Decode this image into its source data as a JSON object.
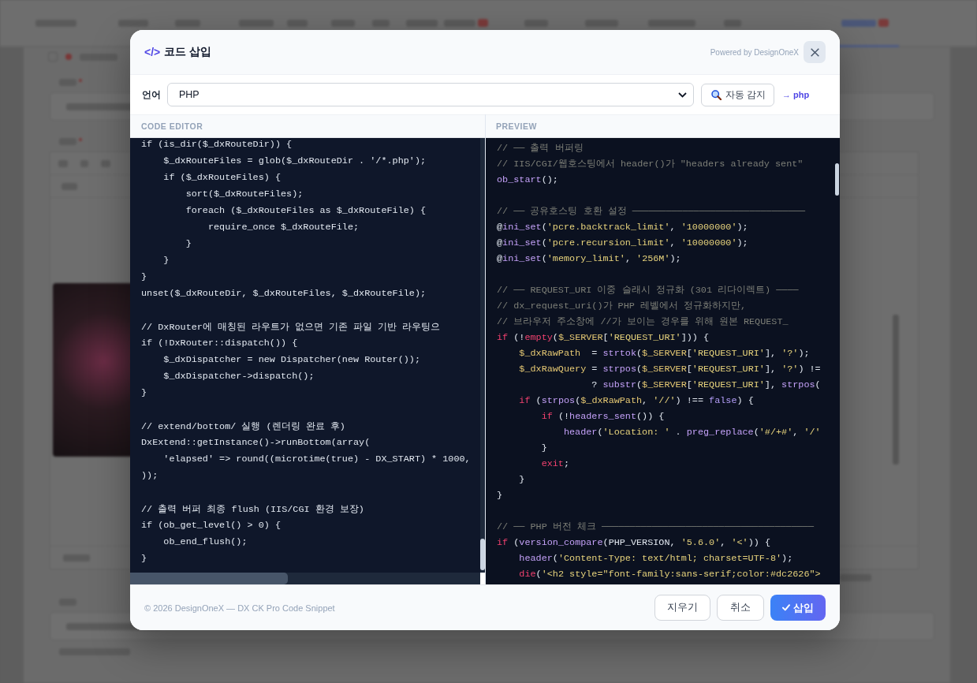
{
  "dialog": {
    "title_icon": "</>",
    "title": "코드 삽입",
    "powered_by": "Powered by DesignOneX"
  },
  "language": {
    "label": "언어",
    "value": "PHP",
    "detect_button": "자동 감지",
    "detected": "→ php"
  },
  "panes": [
    {
      "kind": "editor",
      "heading": "CODE EDITOR",
      "lines": [
        {
          "kind": "code",
          "text": "if (is_dir($_dxRouteDir)) {"
        },
        {
          "kind": "code",
          "text": "    $_dxRouteFiles = glob($_dxRouteDir . '/*.php');"
        },
        {
          "kind": "code",
          "text": "    if ($_dxRouteFiles) {"
        },
        {
          "kind": "code",
          "text": "        sort($_dxRouteFiles);"
        },
        {
          "kind": "code",
          "text": "        foreach ($_dxRouteFiles as $_dxRouteFile) {"
        },
        {
          "kind": "code",
          "text": "            require_once $_dxRouteFile;"
        },
        {
          "kind": "code",
          "text": "        }"
        },
        {
          "kind": "code",
          "text": "    }"
        },
        {
          "kind": "code",
          "text": "}"
        },
        {
          "kind": "code",
          "text": "unset($_dxRouteDir, $_dxRouteFiles, $_dxRouteFile);"
        },
        {
          "kind": "blank"
        },
        {
          "kind": "code",
          "text": "// DxRouter에 매칭된 라우트가 없으면 기존 파일 기반 라우팅으"
        },
        {
          "kind": "code",
          "text": "if (!DxRouter::dispatch()) {"
        },
        {
          "kind": "code",
          "text": "    $_dxDispatcher = new Dispatcher(new Router());"
        },
        {
          "kind": "code",
          "text": "    $_dxDispatcher->dispatch();"
        },
        {
          "kind": "code",
          "text": "}"
        },
        {
          "kind": "blank"
        },
        {
          "kind": "code",
          "text": "// extend/bottom/ 실행 (렌더링 완료 후)"
        },
        {
          "kind": "code",
          "text": "DxExtend::getInstance()->runBottom(array("
        },
        {
          "kind": "code",
          "text": "    'elapsed' => round((microtime(true) - DX_START) * 1000,"
        },
        {
          "kind": "code",
          "text": "));"
        },
        {
          "kind": "blank"
        },
        {
          "kind": "code",
          "text": "// 출력 버퍼 최종 flush (IIS/CGI 환경 보장)"
        },
        {
          "kind": "code",
          "text": "if (ob_get_level() > 0) {"
        },
        {
          "kind": "code",
          "text": "    ob_end_flush();"
        },
        {
          "kind": "code",
          "text": "}"
        }
      ]
    },
    {
      "kind": "preview",
      "heading": "PREVIEW",
      "lines": [
        {
          "kind": "code",
          "tokens": [
            {
              "kind": "comment",
              "text": "// ── 출력 버퍼링"
            }
          ]
        },
        {
          "kind": "code",
          "tokens": [
            {
              "kind": "comment",
              "text": "// IIS/CGI/웹호스팅에서 header()가 \"headers already sent\""
            }
          ]
        },
        {
          "kind": "code",
          "tokens": [
            {
              "kind": "function",
              "text": "ob_start"
            },
            {
              "kind": "plain",
              "text": "();"
            }
          ]
        },
        {
          "kind": "blank"
        },
        {
          "kind": "code",
          "tokens": [
            {
              "kind": "comment",
              "text": "// ── 공유호스팅 호환 설정 ───────────────────────────────"
            }
          ]
        },
        {
          "kind": "code",
          "tokens": [
            {
              "kind": "plain",
              "text": "@"
            },
            {
              "kind": "function",
              "text": "ini_set"
            },
            {
              "kind": "plain",
              "text": "("
            },
            {
              "kind": "string",
              "text": "'pcre.backtrack_limit'"
            },
            {
              "kind": "plain",
              "text": ", "
            },
            {
              "kind": "string",
              "text": "'10000000'"
            },
            {
              "kind": "plain",
              "text": ");"
            }
          ]
        },
        {
          "kind": "code",
          "tokens": [
            {
              "kind": "plain",
              "text": "@"
            },
            {
              "kind": "function",
              "text": "ini_set"
            },
            {
              "kind": "plain",
              "text": "("
            },
            {
              "kind": "string",
              "text": "'pcre.recursion_limit'"
            },
            {
              "kind": "plain",
              "text": ", "
            },
            {
              "kind": "string",
              "text": "'10000000'"
            },
            {
              "kind": "plain",
              "text": ");"
            }
          ]
        },
        {
          "kind": "code",
          "tokens": [
            {
              "kind": "plain",
              "text": "@"
            },
            {
              "kind": "function",
              "text": "ini_set"
            },
            {
              "kind": "plain",
              "text": "("
            },
            {
              "kind": "string",
              "text": "'memory_limit'"
            },
            {
              "kind": "plain",
              "text": ", "
            },
            {
              "kind": "string",
              "text": "'256M'"
            },
            {
              "kind": "plain",
              "text": ");"
            }
          ]
        },
        {
          "kind": "blank"
        },
        {
          "kind": "code",
          "tokens": [
            {
              "kind": "comment",
              "text": "// ── REQUEST_URI 이중 슬래시 정규화 (301 리다이렉트) ────"
            }
          ]
        },
        {
          "kind": "code",
          "tokens": [
            {
              "kind": "comment",
              "text": "// dx_request_uri()가 PHP 레벨에서 정규화하지만,"
            }
          ]
        },
        {
          "kind": "code",
          "tokens": [
            {
              "kind": "comment",
              "text": "// 브라우저 주소창에 //가 보이는 경우를 위해 원본 REQUEST_"
            }
          ]
        },
        {
          "kind": "code",
          "tokens": [
            {
              "kind": "keyword",
              "text": "if"
            },
            {
              "kind": "plain",
              "text": " (!"
            },
            {
              "kind": "keyword",
              "text": "empty"
            },
            {
              "kind": "plain",
              "text": "("
            },
            {
              "kind": "variable",
              "text": "$_SERVER"
            },
            {
              "kind": "plain",
              "text": "["
            },
            {
              "kind": "string",
              "text": "'REQUEST_URI'"
            },
            {
              "kind": "plain",
              "text": "])) {"
            }
          ]
        },
        {
          "kind": "code",
          "tokens": [
            {
              "kind": "variable",
              "text": "    $_dxRawPath"
            },
            {
              "kind": "plain",
              "text": "  = "
            },
            {
              "kind": "function",
              "text": "strtok"
            },
            {
              "kind": "plain",
              "text": "("
            },
            {
              "kind": "variable",
              "text": "$_SERVER"
            },
            {
              "kind": "plain",
              "text": "["
            },
            {
              "kind": "string",
              "text": "'REQUEST_URI'"
            },
            {
              "kind": "plain",
              "text": "], "
            },
            {
              "kind": "string",
              "text": "'?'"
            },
            {
              "kind": "plain",
              "text": ");"
            }
          ]
        },
        {
          "kind": "code",
          "tokens": [
            {
              "kind": "variable",
              "text": "    $_dxRawQuery"
            },
            {
              "kind": "plain",
              "text": " = "
            },
            {
              "kind": "function",
              "text": "strpos"
            },
            {
              "kind": "plain",
              "text": "("
            },
            {
              "kind": "variable",
              "text": "$_SERVER"
            },
            {
              "kind": "plain",
              "text": "["
            },
            {
              "kind": "string",
              "text": "'REQUEST_URI'"
            },
            {
              "kind": "plain",
              "text": "], "
            },
            {
              "kind": "string",
              "text": "'?'"
            },
            {
              "kind": "plain",
              "text": ") !="
            }
          ]
        },
        {
          "kind": "code",
          "tokens": [
            {
              "kind": "plain",
              "text": "                 ? "
            },
            {
              "kind": "function",
              "text": "substr"
            },
            {
              "kind": "plain",
              "text": "("
            },
            {
              "kind": "variable",
              "text": "$_SERVER"
            },
            {
              "kind": "plain",
              "text": "["
            },
            {
              "kind": "string",
              "text": "'REQUEST_URI'"
            },
            {
              "kind": "plain",
              "text": "], "
            },
            {
              "kind": "function",
              "text": "strpos"
            },
            {
              "kind": "plain",
              "text": "("
            }
          ]
        },
        {
          "kind": "code",
          "tokens": [
            {
              "kind": "keyword",
              "text": "    if"
            },
            {
              "kind": "plain",
              "text": " ("
            },
            {
              "kind": "function",
              "text": "strpos"
            },
            {
              "kind": "plain",
              "text": "("
            },
            {
              "kind": "variable",
              "text": "$_dxRawPath"
            },
            {
              "kind": "plain",
              "text": ", "
            },
            {
              "kind": "string",
              "text": "'//'"
            },
            {
              "kind": "plain",
              "text": ") !== "
            },
            {
              "kind": "literal",
              "text": "false"
            },
            {
              "kind": "plain",
              "text": ") {"
            }
          ]
        },
        {
          "kind": "code",
          "tokens": [
            {
              "kind": "keyword",
              "text": "        if"
            },
            {
              "kind": "plain",
              "text": " (!"
            },
            {
              "kind": "function",
              "text": "headers_sent"
            },
            {
              "kind": "plain",
              "text": "()) {"
            }
          ]
        },
        {
          "kind": "code",
          "tokens": [
            {
              "kind": "function",
              "text": "            header"
            },
            {
              "kind": "plain",
              "text": "("
            },
            {
              "kind": "string",
              "text": "'Location: '"
            },
            {
              "kind": "plain",
              "text": " . "
            },
            {
              "kind": "function",
              "text": "preg_replace"
            },
            {
              "kind": "plain",
              "text": "("
            },
            {
              "kind": "string",
              "text": "'#/+#'"
            },
            {
              "kind": "plain",
              "text": ", "
            },
            {
              "kind": "string",
              "text": "'/'"
            }
          ]
        },
        {
          "kind": "code",
          "tokens": [
            {
              "kind": "plain",
              "text": "        }"
            }
          ]
        },
        {
          "kind": "code",
          "tokens": [
            {
              "kind": "keyword",
              "text": "        exit"
            },
            {
              "kind": "plain",
              "text": ";"
            }
          ]
        },
        {
          "kind": "code",
          "tokens": [
            {
              "kind": "plain",
              "text": "    }"
            }
          ]
        },
        {
          "kind": "code",
          "tokens": [
            {
              "kind": "plain",
              "text": "}"
            }
          ]
        },
        {
          "kind": "blank"
        },
        {
          "kind": "code",
          "tokens": [
            {
              "kind": "comment",
              "text": "// ── PHP 버전 체크 ──────────────────────────────────────"
            }
          ]
        },
        {
          "kind": "code",
          "tokens": [
            {
              "kind": "keyword",
              "text": "if"
            },
            {
              "kind": "plain",
              "text": " ("
            },
            {
              "kind": "function",
              "text": "version_compare"
            },
            {
              "kind": "plain",
              "text": "(PHP_VERSION, "
            },
            {
              "kind": "string",
              "text": "'5.6.0'"
            },
            {
              "kind": "plain",
              "text": ", "
            },
            {
              "kind": "string",
              "text": "'<'"
            },
            {
              "kind": "plain",
              "text": ")) {"
            }
          ]
        },
        {
          "kind": "code",
          "tokens": [
            {
              "kind": "function",
              "text": "    header"
            },
            {
              "kind": "plain",
              "text": "("
            },
            {
              "kind": "string",
              "text": "'Content-Type: text/html; charset=UTF-8'"
            },
            {
              "kind": "plain",
              "text": ");"
            }
          ]
        },
        {
          "kind": "code",
          "tokens": [
            {
              "kind": "keyword",
              "text": "    die"
            },
            {
              "kind": "plain",
              "text": "("
            },
            {
              "kind": "string",
              "text": "'<h2 style=\"font-family:sans-serif;color:#dc2626\">"
            }
          ]
        }
      ]
    }
  ],
  "footer": {
    "copyright": "© 2026 DesignOneX — DX CK Pro Code Snippet",
    "buttons": [
      {
        "label": "지우기",
        "kind": "secondary"
      },
      {
        "label": "취소",
        "kind": "secondary"
      },
      {
        "label": "삽입",
        "kind": "primary"
      }
    ]
  }
}
